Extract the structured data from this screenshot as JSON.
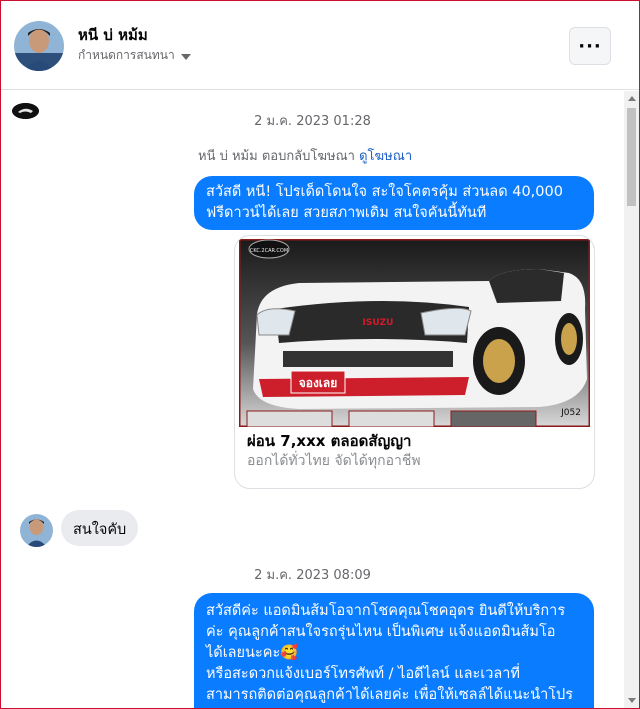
{
  "header": {
    "name": "หนี บ่ หม้ม",
    "subtitle": "กำหนดการสนทนา",
    "more_label": "···"
  },
  "conversation": {
    "timestamp_1": "2 ม.ค. 2023 01:28",
    "reply_note": "หนี บ่ หม้ม ตอบกลับโฆษณา",
    "reply_link": "ดูโฆษณา",
    "message_1_line1": "สวัสดี หนี! โปรเด็ดโดนใจ สะใจโคตรคุ้ม ส่วนลด 40,000",
    "message_1_line2": "ฟรีดาวน์ได้เลย สวยสภาพเดิม สนใจคันนี้ทันที",
    "ad_card": {
      "image_badge": "จองเลย",
      "image_code": "J052",
      "image_brand": "ISUZU",
      "image_logo_text": "CKC.2CAR.COM",
      "title": "ผ่อน 7,xxx ตลอดสัญญา",
      "subtitle": "ออกได้ทั่วไทย จัดได้ทุกอาชีพ"
    },
    "message_2": "สนใจคับ",
    "timestamp_2": "2 ม.ค. 2023 08:09",
    "message_3_lines": [
      "สวัสดีค่ะ แอดมินส้มโอจากโชคคุณโชคอุดร ยินดีให้บริการ",
      "ค่ะ   คุณลูกค้าสนใจรถรุ่นไหน เป็นพิเศษ แจ้งแอดมินส้มโอ",
      "ได้เลยนะคะ🥰",
      "หรือสะดวกแจ้งเบอร์โทรศัพท์ / ไอดีไลน์ และเวลาที่",
      "สามารถติดต่อคุณลูกค้าได้เลยค่ะ เพื่อให้เซลล์ได้แนะนำโปร"
    ]
  },
  "colors": {
    "outgoing_bubble": "#0a7cff",
    "incoming_bubble": "#e9ebee",
    "link": "#1b5ec9",
    "secondary_text": "#65676b"
  },
  "icons": [
    "more-icon",
    "caret-down-icon",
    "scroll-up-icon",
    "scroll-down-icon"
  ]
}
